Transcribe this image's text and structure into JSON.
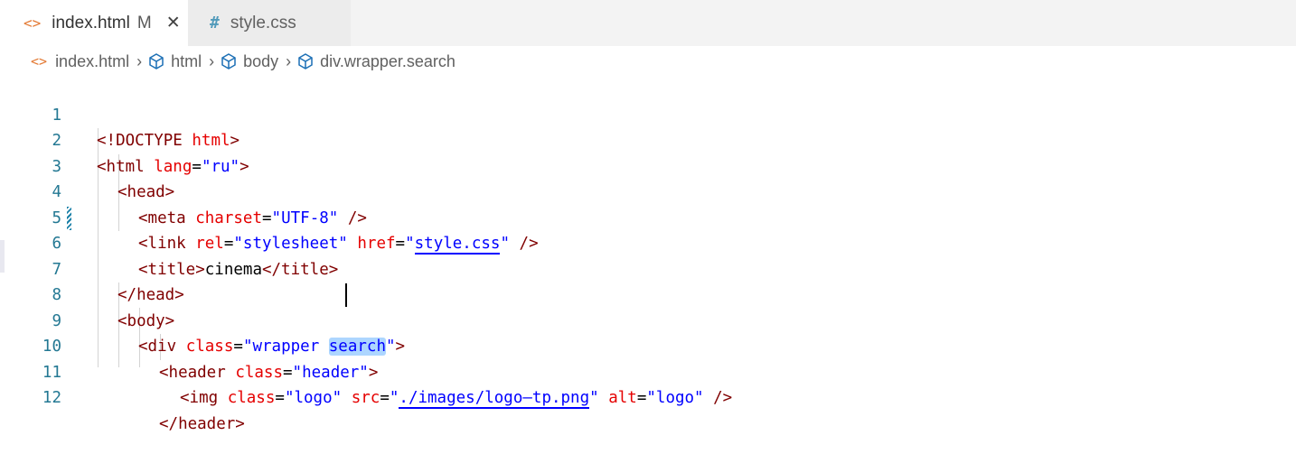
{
  "tabs": [
    {
      "icon": "<>",
      "label": "index.html",
      "modified": "M",
      "close": "✕",
      "active": true
    },
    {
      "icon": "#",
      "label": "style.css",
      "active": false
    }
  ],
  "breadcrumb": {
    "file_icon": "<>",
    "items": [
      "index.html",
      "html",
      "body",
      "div.wrapper.search"
    ],
    "separator": "›"
  },
  "editor": {
    "line_numbers": [
      "1",
      "2",
      "3",
      "4",
      "5",
      "6",
      "7",
      "8",
      "9",
      "10",
      "11",
      "12"
    ],
    "colors": {
      "tag": "#800000",
      "attribute": "#e50000",
      "string": "#0000ff",
      "line_number": "#237893"
    },
    "lines": [
      {
        "parts": [
          "<!DOCTYPE",
          " ",
          "html",
          ">"
        ]
      },
      {
        "parts": [
          "<html",
          " ",
          "lang",
          "=",
          "\"ru\"",
          ">"
        ]
      },
      {
        "parts": [
          "<head>"
        ]
      },
      {
        "parts": [
          "<meta",
          " ",
          "charset",
          "=",
          "\"UTF-8\"",
          " />"
        ]
      },
      {
        "parts": [
          "<link",
          " ",
          "rel",
          "=",
          "\"stylesheet\"",
          " ",
          "href",
          "=",
          "\"",
          "style.css",
          "\"",
          " />"
        ]
      },
      {
        "parts": [
          "<title>",
          "cinema",
          "</title>"
        ]
      },
      {
        "parts": [
          "</head>"
        ]
      },
      {
        "parts": [
          "<body>"
        ]
      },
      {
        "parts": [
          "<div",
          " ",
          "class",
          "=",
          "\"wrapper ",
          "search",
          "\"",
          ">"
        ]
      },
      {
        "parts": [
          "<header",
          " ",
          "class",
          "=",
          "\"header\"",
          ">"
        ]
      },
      {
        "parts": [
          "<img",
          " ",
          "class",
          "=",
          "\"logo\"",
          " ",
          "src",
          "=",
          "\"",
          "./images/logo—tp.png",
          "\"",
          " ",
          "alt",
          "=",
          "\"logo\"",
          " />"
        ]
      },
      {
        "parts": [
          "</header>"
        ]
      }
    ]
  }
}
